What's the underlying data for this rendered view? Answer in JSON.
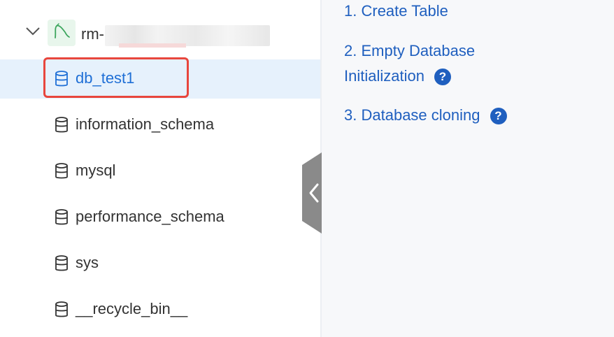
{
  "tree": {
    "instance": {
      "label": "rm-"
    },
    "databases": [
      {
        "name": "db_test1"
      },
      {
        "name": "information_schema"
      },
      {
        "name": "mysql"
      },
      {
        "name": "performance_schema"
      },
      {
        "name": "sys"
      },
      {
        "name": "__recycle_bin__"
      }
    ],
    "selected": "db_test1"
  },
  "steps": [
    {
      "number": "1.",
      "label": "Create Table"
    },
    {
      "number": "2.",
      "label_line1": "Empty Database",
      "label_line2": "Initialization"
    },
    {
      "number": "3.",
      "label": "Database cloning"
    }
  ],
  "help_glyph": "?",
  "colors": {
    "accent": "#1f6fd6",
    "link": "#1f5fbf",
    "selected_bg": "#e6f1fc",
    "highlight_border": "#e8463d",
    "mysql_badge_bg": "#e8f6ec"
  },
  "icons": {
    "expand": "chevron-down-icon",
    "engine": "mysql-icon",
    "database": "database-icon",
    "help": "help-icon",
    "collapse": "chevron-left-icon"
  }
}
